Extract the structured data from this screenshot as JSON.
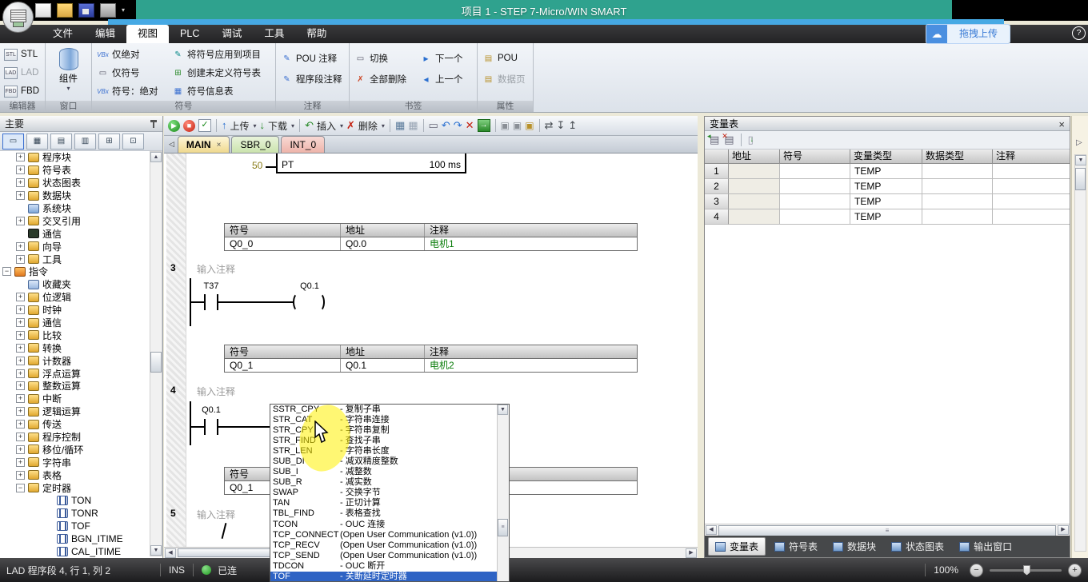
{
  "title_bar": {
    "title": "项目 1 - STEP 7-Micro/WIN SMART"
  },
  "overlay": {
    "drag_upload": "拖拽上传",
    "help": "?"
  },
  "menu": {
    "items": [
      {
        "label": "文件"
      },
      {
        "label": "编辑"
      },
      {
        "label": "视图",
        "cls": "active"
      },
      {
        "label": "PLC"
      },
      {
        "label": "调试"
      },
      {
        "label": "工具"
      },
      {
        "label": "帮助"
      }
    ]
  },
  "ribbon": {
    "editor_group": {
      "label": "编辑器",
      "stl": "STL",
      "lad": "LAD",
      "fbd": "FBD"
    },
    "window_group": {
      "label": "窗口",
      "component": "组件"
    },
    "symbol_group": {
      "label": "符号",
      "abs_only": "仅绝对",
      "sym_only": "仅符号",
      "sym_abs": "符号：绝对",
      "apply": "将符号应用到项目",
      "create": "创建未定义符号表",
      "info": "符号信息表"
    },
    "comment_group": {
      "label": "注释",
      "pou": "POU 注释",
      "network": "程序段注释"
    },
    "bookmark_group": {
      "label": "书签",
      "toggle": "切换",
      "remove_all": "全部删除",
      "next": "下一个",
      "prev": "上一个"
    },
    "property_group": {
      "label": "属性",
      "pou": "POU",
      "data_page": "数据页"
    }
  },
  "project_tree": {
    "header": "主要",
    "items": [
      {
        "label": "程序块",
        "cls": "lvl1 plus"
      },
      {
        "label": "符号表",
        "cls": "lvl1 plus"
      },
      {
        "label": "状态图表",
        "cls": "lvl1 plus"
      },
      {
        "label": "数据块",
        "cls": "lvl1 plus"
      },
      {
        "label": "系统块",
        "cls": "lvl1 leaf ic-sysblock"
      },
      {
        "label": "交叉引用",
        "cls": "lvl1 plus"
      },
      {
        "label": "通信",
        "cls": "lvl1 leaf ic-comm-monitor"
      },
      {
        "label": "向导",
        "cls": "lvl1 plus"
      },
      {
        "label": "工具",
        "cls": "lvl1 plus"
      },
      {
        "label": "指令",
        "cls": "lvl0 minus ic-instr-root"
      },
      {
        "label": "收藏夹",
        "cls": "lvl1 leaf ic-favorites"
      },
      {
        "label": "位逻辑",
        "cls": "lvl1 plus"
      },
      {
        "label": "时钟",
        "cls": "lvl1 plus"
      },
      {
        "label": "通信",
        "cls": "lvl1 plus"
      },
      {
        "label": "比较",
        "cls": "lvl1 plus"
      },
      {
        "label": "转换",
        "cls": "lvl1 plus"
      },
      {
        "label": "计数器",
        "cls": "lvl1 plus"
      },
      {
        "label": "浮点运算",
        "cls": "lvl1 plus"
      },
      {
        "label": "整数运算",
        "cls": "lvl1 plus"
      },
      {
        "label": "中断",
        "cls": "lvl1 plus"
      },
      {
        "label": "逻辑运算",
        "cls": "lvl1 plus"
      },
      {
        "label": "传送",
        "cls": "lvl1 plus"
      },
      {
        "label": "程序控制",
        "cls": "lvl1 plus"
      },
      {
        "label": "移位/循环",
        "cls": "lvl1 plus"
      },
      {
        "label": "字符串",
        "cls": "lvl1 plus"
      },
      {
        "label": "表格",
        "cls": "lvl1 plus"
      },
      {
        "label": "定时器",
        "cls": "lvl1 minus"
      },
      {
        "label": "TON",
        "cls": "lvl2 leaf ic-instruction"
      },
      {
        "label": "TONR",
        "cls": "lvl2 leaf ic-instruction"
      },
      {
        "label": "TOF",
        "cls": "lvl2 leaf ic-instruction"
      },
      {
        "label": "BGN_ITIME",
        "cls": "lvl2 leaf ic-instruction"
      },
      {
        "label": "CAL_ITIME",
        "cls": "lvl2 leaf ic-instruction"
      }
    ]
  },
  "editor": {
    "toolbar": {
      "upload": "上传",
      "download": "下载",
      "insert": "插入",
      "delete": "删除"
    },
    "tabs": {
      "main": "MAIN",
      "sbr": "SBR_0",
      "int": "INT_0"
    },
    "net2": {
      "pt_value": "50",
      "pt_label": "PT",
      "time_base": "100 ms"
    },
    "net3": {
      "num": "3",
      "comment": "输入注释",
      "contact_label": "T37",
      "coil_label": "Q0.1"
    },
    "net4": {
      "num": "4",
      "comment": "输入注释",
      "contact_label": "Q0.1"
    },
    "net5": {
      "num": "5",
      "comment": "输入注释"
    },
    "symtable_headers": {
      "sym": "符号",
      "addr": "地址",
      "cmt": "注释"
    },
    "symtable1": {
      "sym": "Q0_0",
      "addr": "Q0.0",
      "cmt": "电机1"
    },
    "symtable2": {
      "sym": "Q0_1",
      "addr": "Q0.1",
      "cmt": "电机2"
    },
    "symtable3": {
      "sym": "Q0_1",
      "addr": "",
      "cmt": ""
    }
  },
  "instruction_list": {
    "items": [
      {
        "name": "SSTR_CPY",
        "desc": "- 复制子串"
      },
      {
        "name": "STR_CAT",
        "desc": "- 字符串连接"
      },
      {
        "name": "STR_CPY",
        "desc": "- 字符串复制"
      },
      {
        "name": "STR_FIND",
        "desc": "- 查找子串"
      },
      {
        "name": "STR_LEN",
        "desc": "- 字符串长度"
      },
      {
        "name": "SUB_DI",
        "desc": "- 减双精度整数"
      },
      {
        "name": "SUB_I",
        "desc": "- 减整数"
      },
      {
        "name": "SUB_R",
        "desc": "- 减实数"
      },
      {
        "name": "SWAP",
        "desc": "- 交换字节"
      },
      {
        "name": "TAN",
        "desc": "- 正切计算"
      },
      {
        "name": "TBL_FIND",
        "desc": "- 表格查找"
      },
      {
        "name": "TCON",
        "desc": "- OUC 连接"
      },
      {
        "name": "TCP_CONNECT",
        "desc": "(Open User Communication (v1.0))"
      },
      {
        "name": "TCP_RECV",
        "desc": "(Open User Communication (v1.0))"
      },
      {
        "name": "TCP_SEND",
        "desc": "(Open User Communication (v1.0))"
      },
      {
        "name": "TDCON",
        "desc": "- OUC 断开"
      },
      {
        "name": "TOF",
        "desc": "- 关断延时定时器",
        "cls": "sel"
      }
    ]
  },
  "variable_table": {
    "title": "变量表",
    "columns": {
      "addr": "地址",
      "sym": "符号",
      "var_type": "变量类型",
      "data_type": "数据类型",
      "cmt": "注释"
    },
    "rows": [
      {
        "num": "1",
        "var_type": "TEMP"
      },
      {
        "num": "2",
        "var_type": "TEMP"
      },
      {
        "num": "3",
        "var_type": "TEMP"
      },
      {
        "num": "4",
        "var_type": "TEMP"
      }
    ],
    "tabs": [
      {
        "label": "变量表",
        "cls": "active"
      },
      {
        "label": "符号表"
      },
      {
        "label": "数据块"
      },
      {
        "label": "状态图表"
      },
      {
        "label": "输出窗口"
      }
    ]
  },
  "status_bar": {
    "position": "LAD 程序段 4, 行 1, 列 2",
    "mode": "INS",
    "connection": "已连",
    "zoom_level": "100%"
  },
  "colors": {
    "titlebar_teal": "#2fa28e",
    "accent_blue": "#46a9e4",
    "selection_blue": "#2e63c4",
    "comment_green": "#0a7d0a"
  }
}
